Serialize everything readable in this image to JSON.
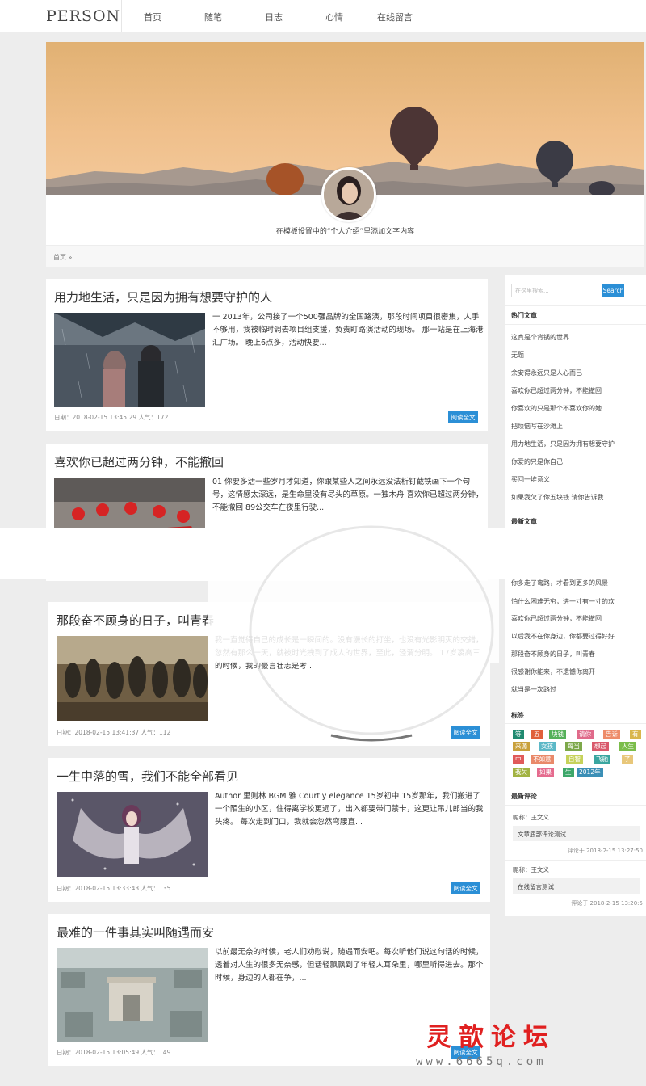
{
  "nav": {
    "logo": "PERSON",
    "items": [
      "首页",
      "随笔",
      "日志",
      "心情",
      "在线留言"
    ]
  },
  "profile": {
    "intro": "在模板设置中的“个人介绍”里添加文字内容"
  },
  "breadcrumb": "首页 »",
  "articles": [
    {
      "title": "用力地生活，只是因为拥有想要守护的人",
      "excerpt": "一 2013年，公司接了一个500强品牌的全国路演，那段时间项目很密集，人手不够用，我被临时调去项目组支援，负责盯路演活动的现场。 那一站是在上海港汇广场。 晚上6点多，活动快要...",
      "meta": "日期：2018-02-15 13:45:29  人气：172",
      "button": "阅读全文"
    },
    {
      "title": "喜欢你已超过两分钟，不能撤回",
      "excerpt": "01 你要多活一些岁月才知道，你跟某些人之间永远没法析钉截铁画下一个句号，这情感太深远，是生命里没有尽头的草原。一独木舟 喜欢你已超过两分钟，不能撤回 89公交车在夜里行驶...",
      "meta": "",
      "button": ""
    },
    {
      "title": "那段奋不顾身的日子，叫青春",
      "excerpt": "我一直觉得自己的成长是一瞬间的。没有漫长的打坐，也没有光影明灭的交錯，忽然有那么一天，就被时光拽到了成人的世界，至此，泾渭分明。 17岁凌高三的时候，我的豪言壮志是考...",
      "meta": "日期：2018-02-15 13:41:37  人气：112",
      "button": "阅读全文"
    },
    {
      "title": "一生中落的雪，我们不能全部看见",
      "excerpt": "Author 里则林 BGM 雅 Courtly elegance 15岁初中 15岁那年，我们搬进了一个陌生的小区，住得离学校更远了，出入都要带门禁卡，这更让吊儿郎当的我头疼。 每次走到门口，我就会忽然弯腰直...",
      "meta": "日期：2018-02-15 13:33:43  人气：135",
      "button": "阅读全文"
    },
    {
      "title": "最难的一件事其实叫随遇而安",
      "excerpt": "以前最无奈的时候，老人们劝慰说，随遇而安吧。每次听他们说这句话的时候，透着对人生的很多无奈感，但话轻飘飘到了年轻人耳朵里，哪里听得进去。那个时候，身边的人都在争，...",
      "meta": "日期：2018-02-15 13:05:49  人气：149",
      "button": "阅读全文"
    }
  ],
  "sidebar": {
    "search_placeholder": "在这里搜索...",
    "search_button": "Search",
    "hot_title": "热门文章",
    "hot": [
      "这真是个背锅的世界",
      "无题",
      "余安得永远只是人心而已",
      "喜欢你已超过两分钟，不能撤回",
      "你喜欢的只是那个不喜欢你的她",
      "把烦恼写在沙滩上",
      "用力地生活，只是因为拥有想要守护",
      "你爱的只是你自己",
      "买回一堆意义",
      "如果我欠了你五块钱 请你告诉我"
    ],
    "new_title": "最新文章",
    "new": [
      "你多走了弯路，才看到更多的风景",
      "怕什么困难无穷，进一寸有一寸的欢",
      "喜欢你已超过两分钟，不能撤回",
      "以后我不在你身边，你都要过得好好",
      "那段奋不顾身的日子，叫青春",
      "很感谢你能来，不遗憾你离开",
      "就当是一次路过"
    ],
    "tags_title": "标签",
    "tags": [
      {
        "text": "等",
        "color": "#1f8a70"
      },
      {
        "text": "五",
        "color": "#e0603b"
      },
      {
        "text": "块钱",
        "color": "#55b059"
      },
      {
        "text": "请你",
        "color": "#e06a8a"
      },
      {
        "text": "告诉",
        "color": "#ee8c6a"
      },
      {
        "text": "有",
        "color": "#d9b64c"
      },
      {
        "text": "来源",
        "color": "#c9a13c"
      },
      {
        "text": "女孩",
        "color": "#5cb8c7"
      },
      {
        "text": "每当",
        "color": "#7da84a"
      },
      {
        "text": "想起",
        "color": "#d9596b"
      },
      {
        "text": "人生",
        "color": "#7bbd4b"
      },
      {
        "text": "中",
        "color": "#e05a5a"
      },
      {
        "text": "不如意",
        "color": "#e9896a"
      },
      {
        "text": "自智",
        "color": "#c6d25a"
      },
      {
        "text": "飞驰",
        "color": "#3aa6a0"
      },
      {
        "text": "了",
        "color": "#e8c77a"
      },
      {
        "text": "我欠",
        "color": "#a2b342"
      },
      {
        "text": "如果",
        "color": "#e56b8e"
      },
      {
        "text": "生",
        "color": "#3da76a"
      },
      {
        "text": "2012年",
        "color": "#3b8fb6"
      }
    ],
    "comments_title": "最新评论",
    "comments": [
      {
        "who": "昵称：王文义",
        "text": "文章底部评论测试",
        "time": "评论于 2018-2-15 13:27:50"
      },
      {
        "who": "昵称：王文义",
        "text": "在线留言测试",
        "time": "评论于 2018-2-15 13:20:5"
      }
    ]
  },
  "watermark": {
    "forum": "灵歆论坛",
    "url": "www.6665q.com"
  }
}
